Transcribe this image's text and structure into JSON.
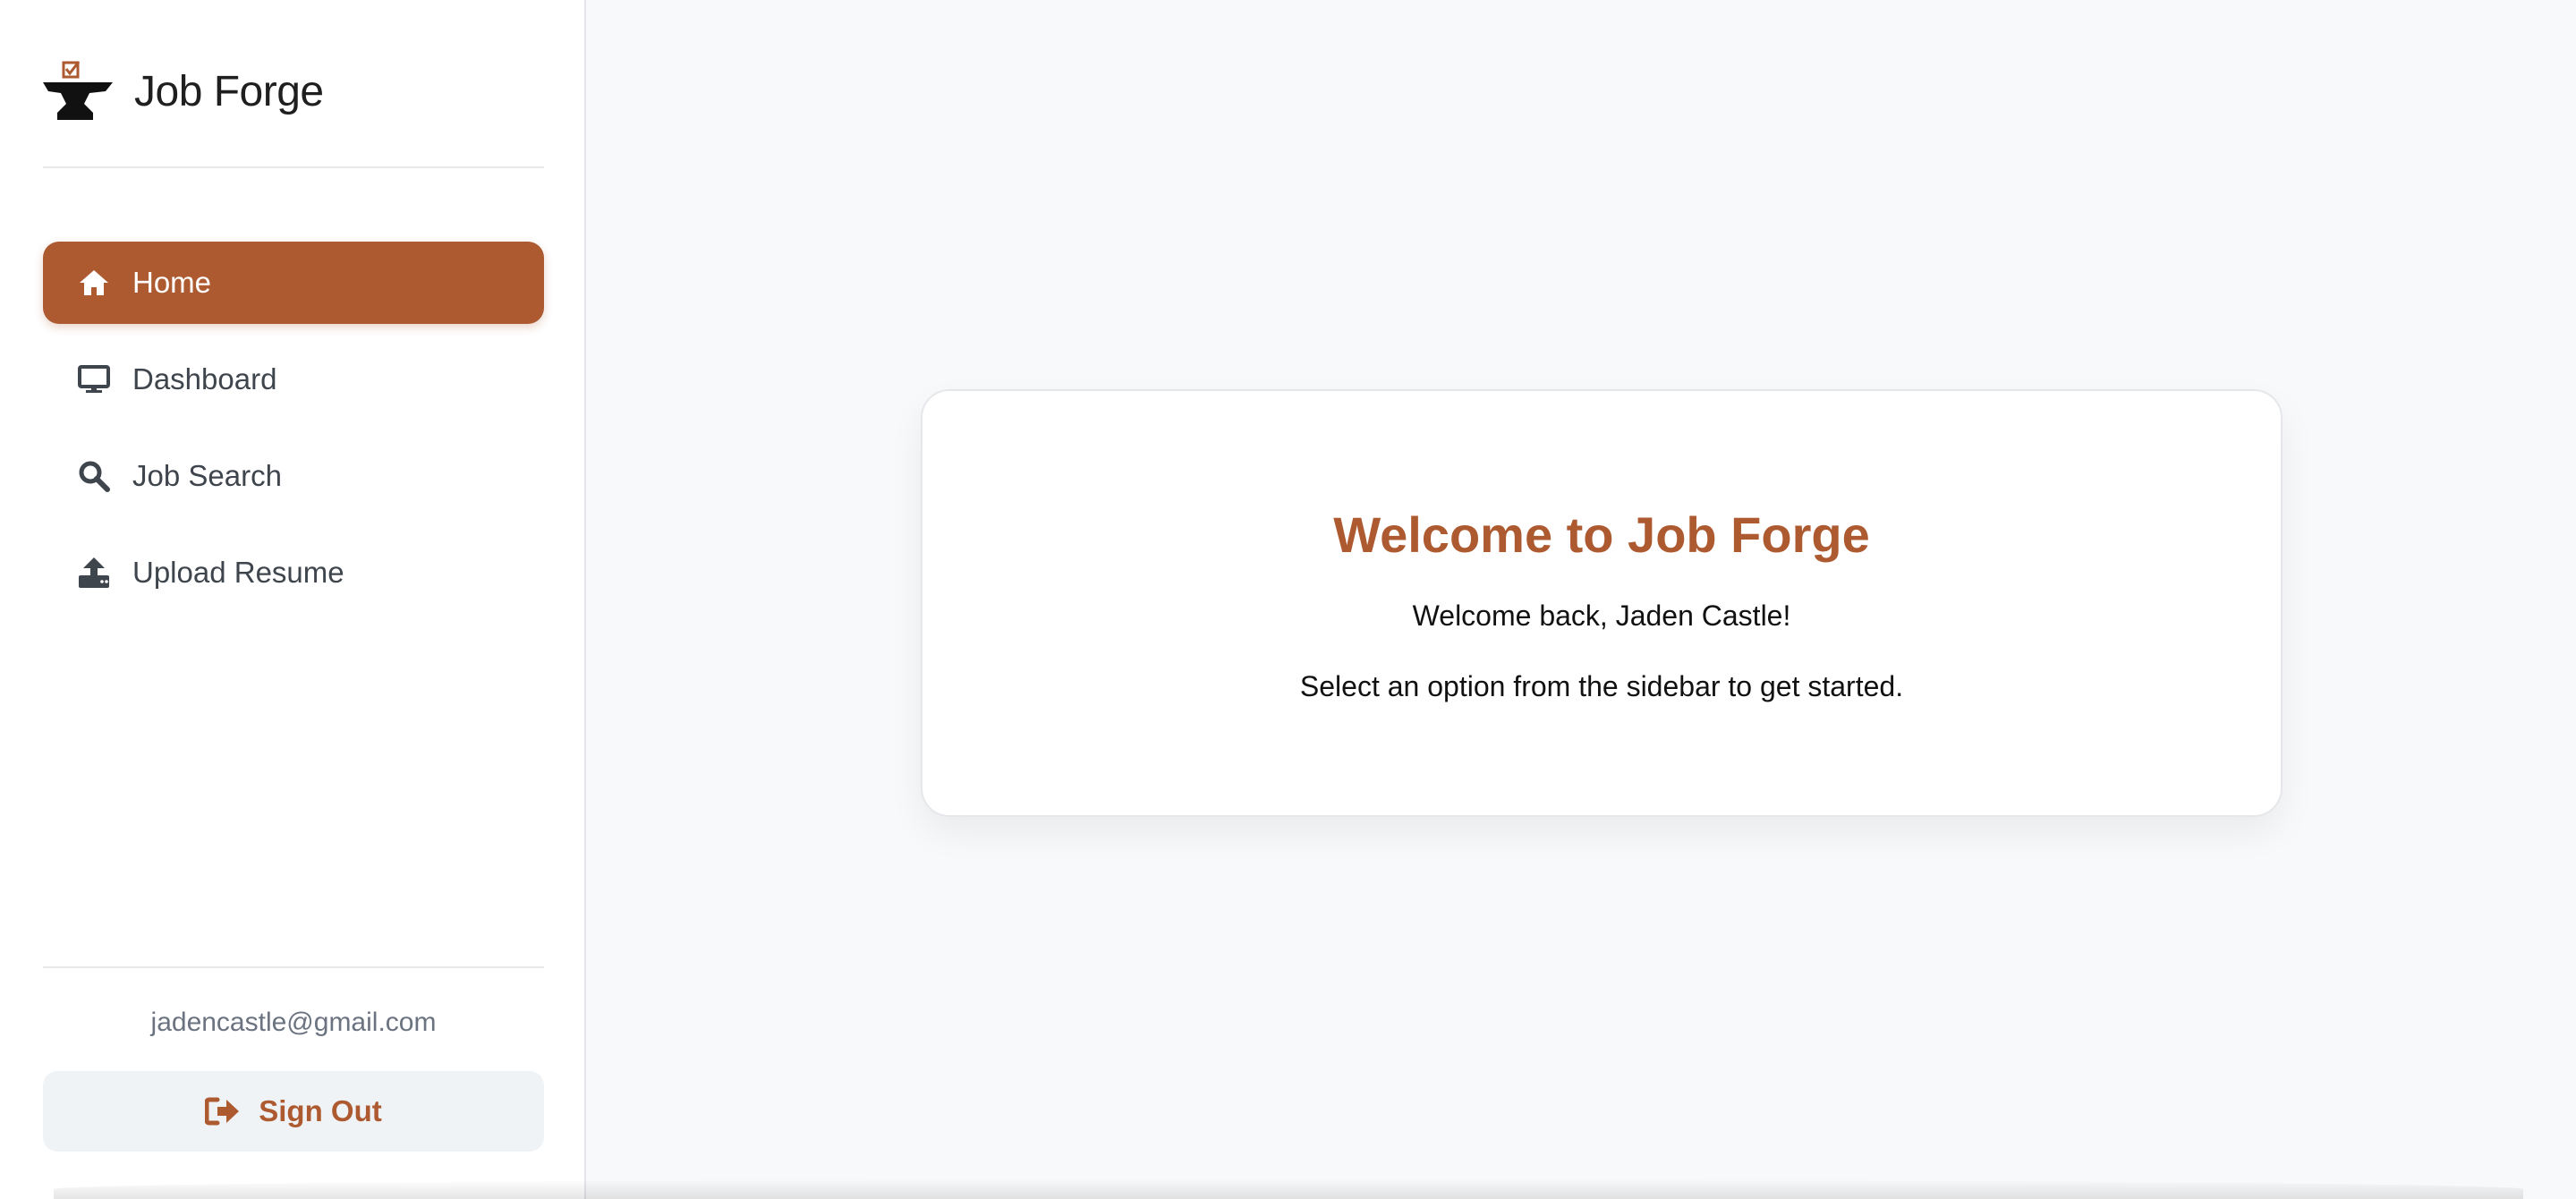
{
  "brand": {
    "name": "Job Forge",
    "logo_icon": "anvil-checkbox-logo"
  },
  "sidebar": {
    "items": [
      {
        "label": "Home",
        "icon": "home-icon",
        "active": true
      },
      {
        "label": "Dashboard",
        "icon": "monitor-icon",
        "active": false
      },
      {
        "label": "Job Search",
        "icon": "search-icon",
        "active": false
      },
      {
        "label": "Upload Resume",
        "icon": "upload-icon",
        "active": false
      }
    ],
    "user_email": "jadencastle@gmail.com",
    "signout_label": "Sign Out"
  },
  "main": {
    "title": "Welcome to Job Forge",
    "greeting": "Welcome back, Jaden Castle!",
    "instruction": "Select an option from the sidebar to get started."
  },
  "colors": {
    "accent": "#ad5a31",
    "sidebar_bg": "#ffffff",
    "page_bg": "#f8f9fa",
    "signout_bg": "#f0f3f6"
  }
}
